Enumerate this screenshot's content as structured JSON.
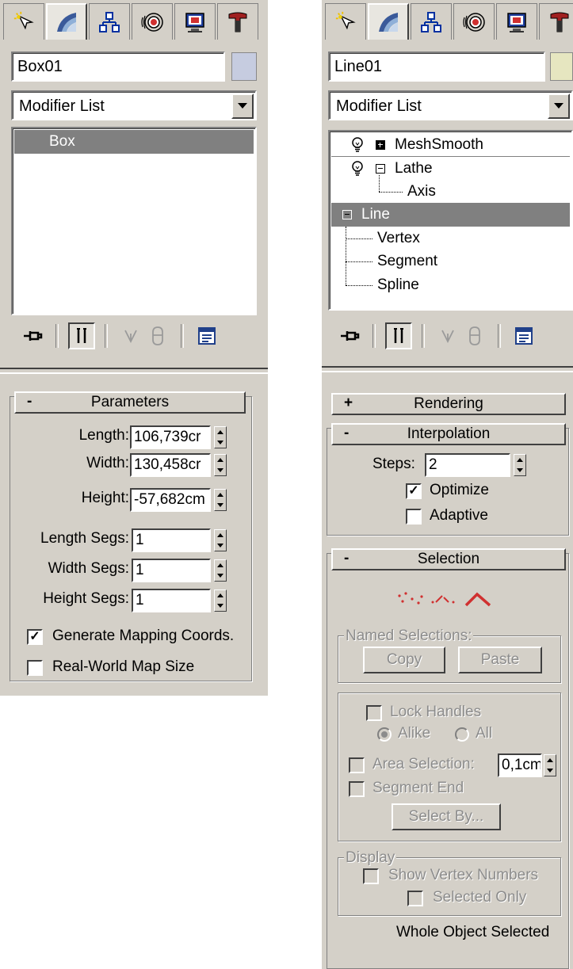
{
  "left_panel": {
    "tabs": [
      "create-icon",
      "modify-icon",
      "hierarchy-icon",
      "motion-icon",
      "display-icon",
      "utilities-icon"
    ],
    "object_name": "Box01",
    "object_color": "#c6cce0",
    "modifier_list": "Modifier List",
    "stack": [
      {
        "label": "Box",
        "selected": true
      }
    ],
    "parameters": {
      "header": "Parameters",
      "toggle": "-",
      "length_label": "Length:",
      "length_value": "106,739cr",
      "width_label": "Width:",
      "width_value": "130,458cr",
      "height_label": "Height:",
      "height_value": "-57,682cm",
      "length_segs_label": "Length Segs:",
      "length_segs_value": "1",
      "width_segs_label": "Width Segs:",
      "width_segs_value": "1",
      "height_segs_label": "Height Segs:",
      "height_segs_value": "1",
      "gen_mapping_label": "Generate Mapping Coords.",
      "gen_mapping_checked": true,
      "real_world_label": "Real-World Map Size",
      "real_world_checked": false
    }
  },
  "right_panel": {
    "tabs": [
      "create-icon",
      "modify-icon",
      "hierarchy-icon",
      "motion-icon",
      "display-icon",
      "utilities-icon"
    ],
    "object_name": "Line01",
    "object_color": "#e6e6c0",
    "modifier_list": "Modifier List",
    "stack": {
      "meshsmooth": "MeshSmooth",
      "lathe": "Lathe",
      "axis": "Axis",
      "line": "Line",
      "vertex": "Vertex",
      "segment": "Segment",
      "spline": "Spline"
    },
    "rendering": {
      "header": "Rendering",
      "toggle": "+"
    },
    "interpolation": {
      "header": "Interpolation",
      "toggle": "-",
      "steps_label": "Steps:",
      "steps_value": "2",
      "optimize_label": "Optimize",
      "optimize_checked": true,
      "adaptive_label": "Adaptive",
      "adaptive_checked": false
    },
    "selection": {
      "header": "Selection",
      "toggle": "-",
      "named_selections_label": "Named Selections:",
      "copy_label": "Copy",
      "paste_label": "Paste",
      "lock_handles_label": "Lock Handles",
      "alike_label": "Alike",
      "all_label": "All",
      "area_selection_label": "Area Selection:",
      "area_selection_value": "0,1cm",
      "segment_end_label": "Segment End",
      "select_by_label": "Select By...",
      "display_label": "Display",
      "show_vertex_numbers_label": "Show Vertex Numbers",
      "selected_only_label": "Selected Only",
      "status": "Whole Object Selected"
    }
  },
  "colors": {
    "panel": "#d4d0c8",
    "subobject_accent": "#d03030"
  }
}
